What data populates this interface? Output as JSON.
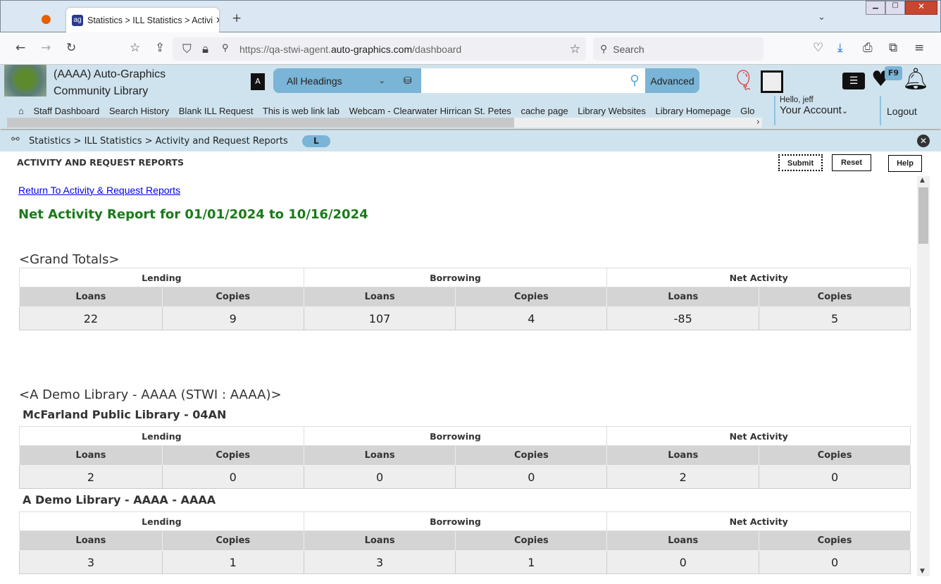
{
  "browser": {
    "tab_title": "Statistics > ILL Statistics > Activi",
    "url_prefix": "https://qa-stwi-agent.",
    "url_domain": "auto-graphics.com",
    "url_path": "/dashboard",
    "search_placeholder": "Search"
  },
  "header": {
    "library_line1": "(AAAA) Auto-Graphics",
    "library_line2": "Community Library",
    "search_scope": "All Headings",
    "advanced_label": "Advanced",
    "badge": "F9",
    "greeting": "Hello, jeff",
    "account_label": "Your Account",
    "logout_label": "Logout",
    "nav_links": [
      "Staff Dashboard",
      "Search History",
      "Blank ILL Request",
      "This is web link lab",
      "Webcam - Clearwater Hirrican St. Petes",
      "cache page",
      "Library Websites",
      "Library Homepage",
      "Glo"
    ]
  },
  "breadcrumb": {
    "text": "Statistics > ILL Statistics > Activity and Request Reports",
    "pill": "L"
  },
  "page": {
    "title": "ACTIVITY AND REQUEST REPORTS",
    "submit": "Submit",
    "reset": "Reset",
    "help": "Help",
    "return_link": "Return To Activity & Request Reports",
    "report_title": "Net Activity Report for 01/01/2024 to 10/16/2024",
    "grand_totals": "<Grand Totals>",
    "group_title": "<A Demo Library - AAAA (STWI : AAAA)>"
  },
  "columns": {
    "groups": [
      "Lending",
      "Borrowing",
      "Net Activity"
    ],
    "cols": [
      "Loans",
      "Copies",
      "Loans",
      "Copies",
      "Loans",
      "Copies"
    ]
  },
  "tables": [
    {
      "title": "",
      "values": [
        "22",
        "9",
        "107",
        "4",
        "-85",
        "5"
      ]
    },
    {
      "title": "McFarland Public Library - 04AN",
      "values": [
        "2",
        "0",
        "0",
        "0",
        "2",
        "0"
      ]
    },
    {
      "title": "A Demo Library - AAAA - AAAA",
      "values": [
        "3",
        "1",
        "3",
        "1",
        "0",
        "0"
      ]
    }
  ]
}
